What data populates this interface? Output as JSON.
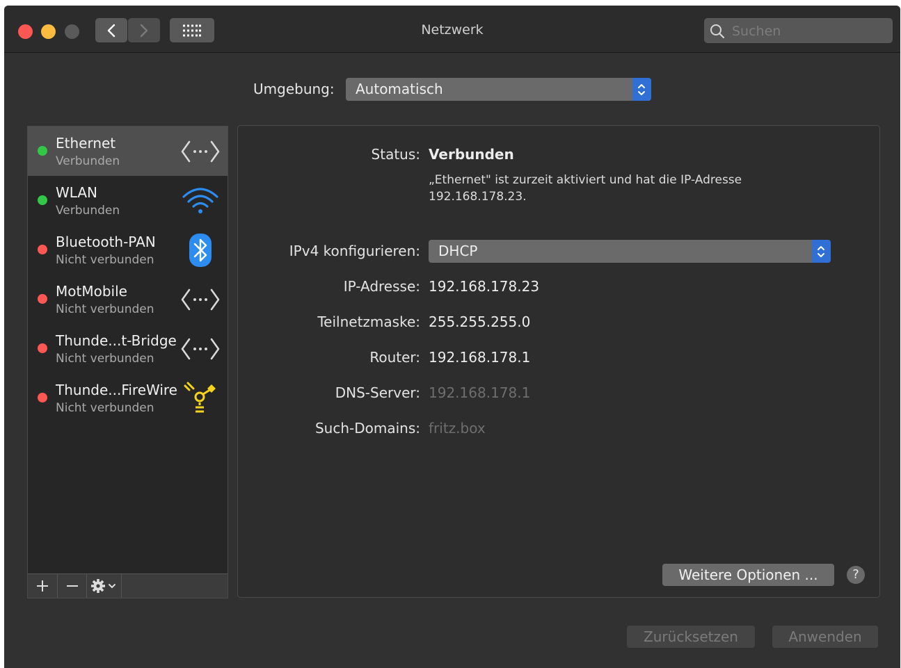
{
  "window": {
    "title": "Netzwerk"
  },
  "toolbar": {
    "search_placeholder": "Suchen"
  },
  "environment": {
    "label": "Umgebung:",
    "value": "Automatisch"
  },
  "services": [
    {
      "name": "Ethernet",
      "status": "Verbunden",
      "status_color": "#33c748",
      "icon": "ethernet-icon",
      "selected": true
    },
    {
      "name": "WLAN",
      "status": "Verbunden",
      "status_color": "#33c748",
      "icon": "wifi-icon",
      "selected": false
    },
    {
      "name": "Bluetooth-PAN",
      "status": "Nicht verbunden",
      "status_color": "#fc5753",
      "icon": "bluetooth-icon",
      "selected": false
    },
    {
      "name": "MotMobile",
      "status": "Nicht verbunden",
      "status_color": "#fc5753",
      "icon": "ethernet-icon",
      "selected": false
    },
    {
      "name": "Thunde...t-Bridge",
      "status": "Nicht verbunden",
      "status_color": "#fc5753",
      "icon": "ethernet-icon",
      "selected": false
    },
    {
      "name": "Thunde...FireWire",
      "status": "Nicht verbunden",
      "status_color": "#fc5753",
      "icon": "firewire-icon",
      "selected": false
    }
  ],
  "detail": {
    "status_label": "Status:",
    "status_value": "Verbunden",
    "description": "„Ethernet\" ist zurzeit aktiviert und hat die IP-Adresse 192.168.178.23.",
    "ipv4_label": "IPv4 konfigurieren:",
    "ipv4_value": "DHCP",
    "ip_label": "IP-Adresse:",
    "ip_value": "192.168.178.23",
    "subnet_label": "Teilnetzmaske:",
    "subnet_value": "255.255.255.0",
    "router_label": "Router:",
    "router_value": "192.168.178.1",
    "dns_label": "DNS-Server:",
    "dns_value": "192.168.178.1",
    "domains_label": "Such-Domains:",
    "domains_value": "fritz.box",
    "advanced_button": "Weitere Optionen ...",
    "help_button": "?"
  },
  "footer": {
    "revert_button": "Zurücksetzen",
    "apply_button": "Anwenden"
  },
  "colors": {
    "accent": "#2f6fd6",
    "connected": "#33c748",
    "disconnected": "#fc5753",
    "firewire": "#f5d31b",
    "bluetooth": "#2d8cf0"
  }
}
